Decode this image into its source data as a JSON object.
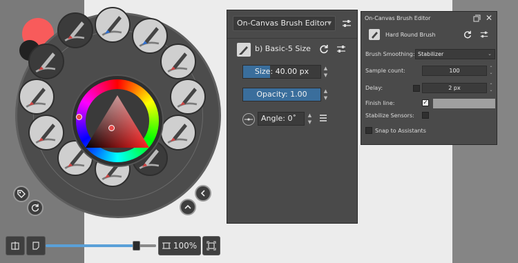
{
  "palette": {
    "foreground_color": "#f85b5b",
    "background_color": "#222222",
    "presets": [
      "ink-pen",
      "eraser-hard",
      "eraser-soft",
      "airbrush-soft",
      "paint-smudge",
      "ink-brush",
      "basic-round",
      "ink-fine",
      "pencil-blend",
      "chalk",
      "pencil-soft",
      "marker-dark"
    ]
  },
  "brush_editor_large": {
    "preset_combo_label": "On-Canvas Brush Editor",
    "brush_name": "b) Basic-5 Size",
    "size_label": "Size: 40.00 px",
    "size_fraction": 0.35,
    "opacity_label": "Opacity: 1.00",
    "opacity_fraction": 1.0,
    "angle_label": "Angle: 0˚"
  },
  "brush_editor_small": {
    "title": "On-Canvas Brush Editor",
    "brush_name": "Hard Round Brush",
    "smoothing_label": "Brush Smoothing:",
    "smoothing_value": "Stabilizer",
    "sample_count_label": "Sample count:",
    "sample_count_value": "100",
    "delay_label": "Delay:",
    "delay_value": "2 px",
    "finish_line_label": "Finish line:",
    "stabilize_sensors_label": "Stabilize Sensors:",
    "snap_label": "Snap to Assistants"
  },
  "toolbar": {
    "zoom_label": "100%",
    "zoom_fraction": 0.82
  }
}
